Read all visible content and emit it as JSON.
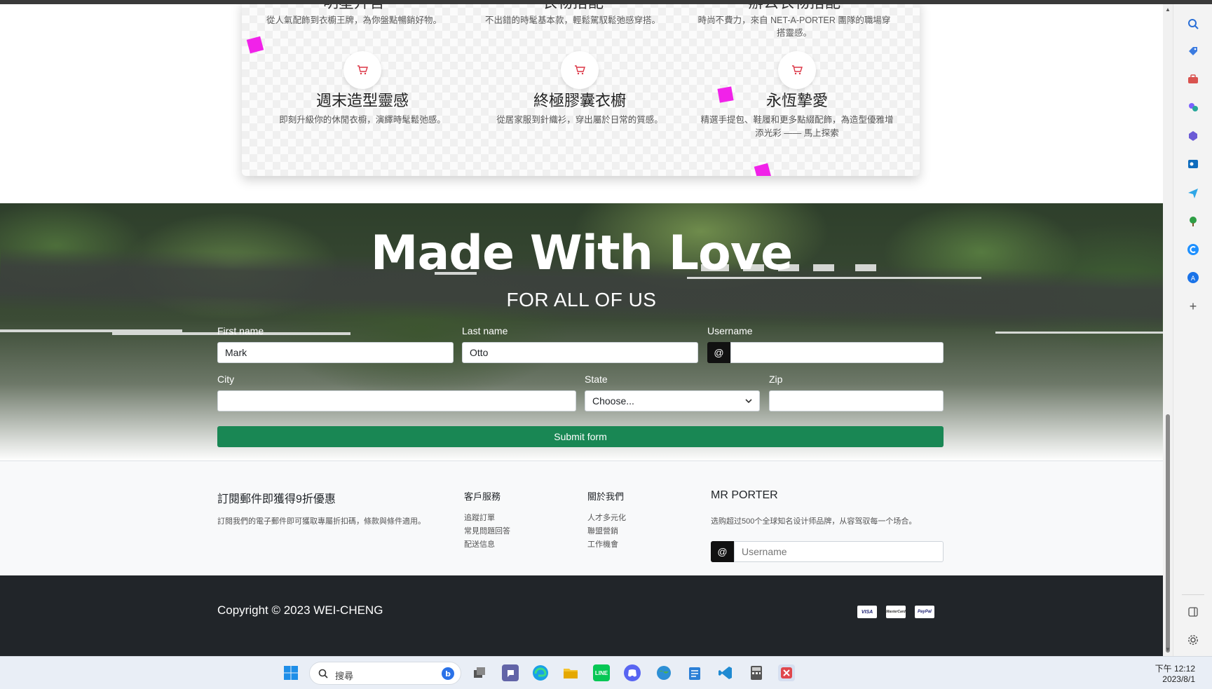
{
  "categories": {
    "top_row": [
      {
        "title": "明星升言",
        "desc": "從人氣配飾到衣櫥王牌，為你盤點暢銷好物。"
      },
      {
        "title": "衣物搭配",
        "desc": "不出錯的時髦基本款，輕鬆駕馭鬆弛感穿搭。"
      },
      {
        "title": "辦公衣物搭配",
        "desc": "時尚不費力，來自 NET-A-PORTER 團隊的職場穿搭靈感。"
      }
    ],
    "bottom_row": [
      {
        "title": "週末造型靈感",
        "desc": "即刻升級你的休閒衣櫥，演繹時髦鬆弛感。"
      },
      {
        "title": "終極膠囊衣櫥",
        "desc": "從居家服到針織衫，穿出屬於日常的質感。"
      },
      {
        "title": "永恆摯愛",
        "desc": "精選手提包、鞋履和更多點綴配飾，為造型優雅增添光彩 —— 馬上探索"
      }
    ]
  },
  "hero": {
    "title": "Made With Love",
    "subtitle": "FOR ALL OF US"
  },
  "form": {
    "first_name_label": "First name",
    "first_name_value": "Mark",
    "last_name_label": "Last name",
    "last_name_value": "Otto",
    "username_label": "Username",
    "username_prefix": "@",
    "username_value": "",
    "city_label": "City",
    "city_value": "",
    "state_label": "State",
    "state_selected": "Choose...",
    "zip_label": "Zip",
    "zip_value": "",
    "submit_label": "Submit form"
  },
  "footer_links": {
    "subscribe_title": "訂閱郵件即獲得9折優惠",
    "subscribe_text": "訂閱我們的電子郵件即可獲取專屬折扣碼，條款與條件適用。",
    "service_title": "客戶服務",
    "service_links": [
      "追蹤訂單",
      "常見問題回答",
      "配送信息"
    ],
    "about_title": "關於我們",
    "about_links": [
      "人才多元化",
      "聯盟營銷",
      "工作機會"
    ],
    "brand_title": "MR PORTER",
    "brand_text": "选购超过500个全球知名设计师品牌，从容驾驭每一个场合。",
    "newsletter_prefix": "@",
    "newsletter_placeholder": "Username"
  },
  "footer": {
    "copyright": "Copyright © 2023 WEI-CHENG",
    "payments": [
      "VISA",
      "MasterCard",
      "PayPal"
    ]
  },
  "taskbar": {
    "search_text": "搜尋",
    "time": "下午 12:12",
    "date": "2023/8/1"
  },
  "colors": {
    "accent_green": "#198754",
    "pink": "#f122e9",
    "dark_footer": "#212529",
    "cart_red": "#dc3545"
  }
}
